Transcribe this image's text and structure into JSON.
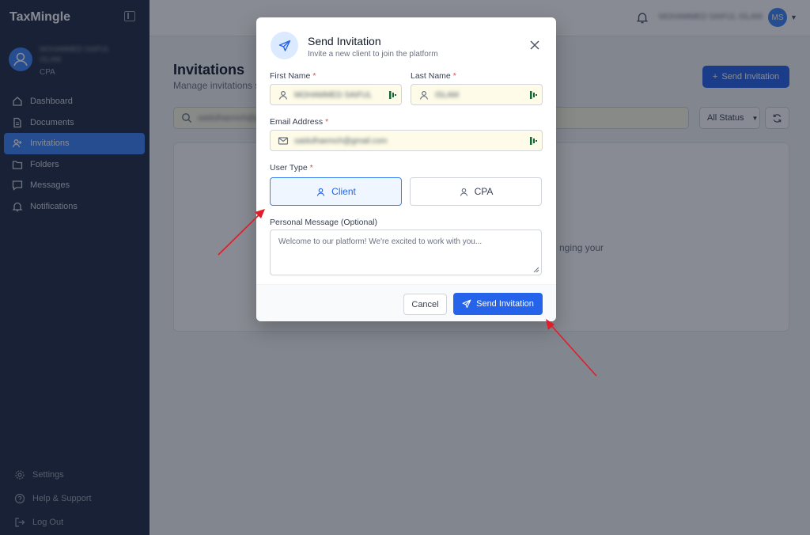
{
  "app": {
    "brand": "TaxMingle"
  },
  "sidebar": {
    "profile": {
      "name": "MOHAMMED SAIFUL ISLAM",
      "role": "CPA"
    },
    "nav": [
      {
        "label": "Dashboard",
        "icon": "home-icon"
      },
      {
        "label": "Documents",
        "icon": "document-icon"
      },
      {
        "label": "Invitations",
        "icon": "user-plus-icon",
        "active": true
      },
      {
        "label": "Folders",
        "icon": "folder-icon"
      },
      {
        "label": "Messages",
        "icon": "message-icon"
      },
      {
        "label": "Notifications",
        "icon": "bell-icon"
      }
    ],
    "bottom": [
      {
        "label": "Settings",
        "icon": "gear-icon"
      },
      {
        "label": "Help & Support",
        "icon": "help-icon"
      },
      {
        "label": "Log Out",
        "icon": "logout-icon"
      }
    ]
  },
  "topbar": {
    "user_name": "MOHAMMED SAIFUL ISLAM",
    "user_initials": "MS"
  },
  "page": {
    "title": "Invitations",
    "subtitle": "Manage invitations s",
    "send_button": "Send Invitation",
    "search_value": "saidulhaemch@g",
    "status_filter": "All Status",
    "empty_text": "nging your"
  },
  "modal": {
    "title": "Send Invitation",
    "subtitle": "Invite a new client to join the platform",
    "first_name": {
      "label": "First Name",
      "value": "MOHAMMED SAIFUL"
    },
    "last_name": {
      "label": "Last Name",
      "value": "ISLAM"
    },
    "email": {
      "label": "Email Address",
      "value": "saidulhaemch@gmail.com"
    },
    "user_type": {
      "label": "User Type",
      "options": [
        "Client",
        "CPA"
      ],
      "selected": "Client"
    },
    "message": {
      "label": "Personal Message (Optional)",
      "placeholder": "Welcome to our platform! We're excited to work with you..."
    },
    "cancel_label": "Cancel",
    "send_label": "Send Invitation",
    "required_mark": "*"
  },
  "colors": {
    "accent": "#2563eb",
    "sidebar": "#1f2a44",
    "annotation": "#e11d2a",
    "autofill": "#fefce8"
  }
}
